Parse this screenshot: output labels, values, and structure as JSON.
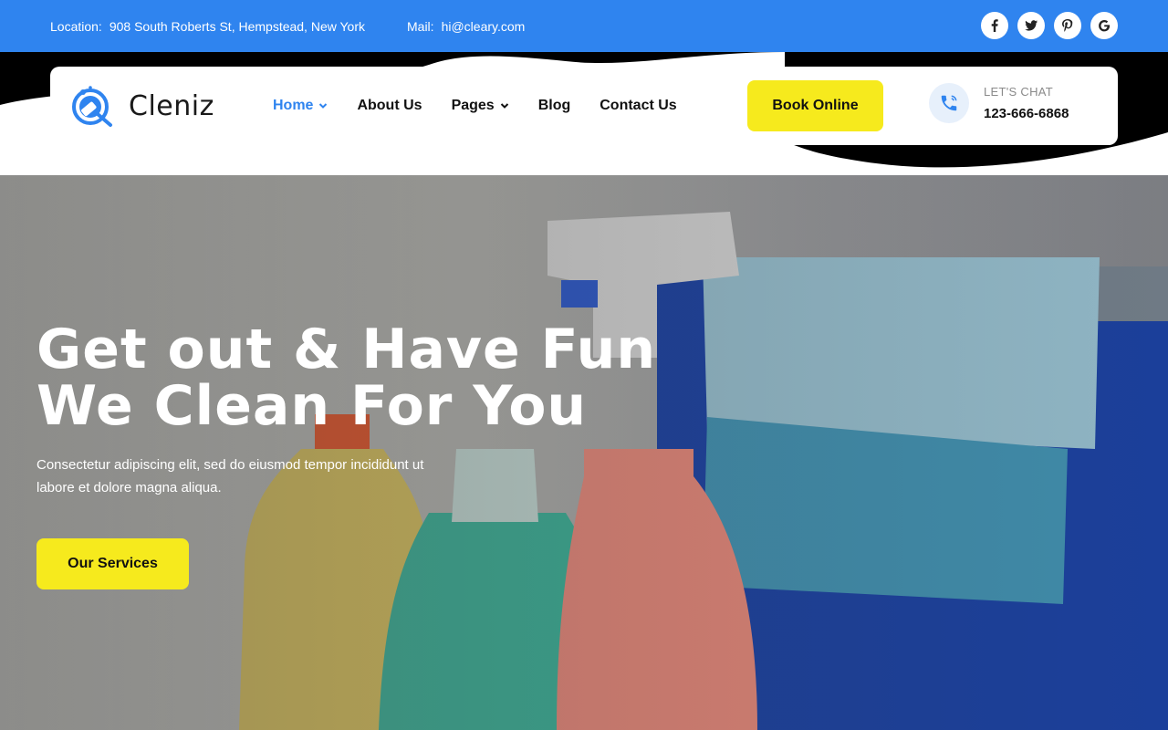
{
  "topbar": {
    "location_label": "Location:",
    "location_value": "908 South Roberts St, Hempstead, New York",
    "mail_label": "Mail:",
    "mail_value": "hi@cleary.com",
    "social": [
      "facebook-icon",
      "twitter-icon",
      "pinterest-icon",
      "google-icon"
    ]
  },
  "brand": {
    "name": "Cleniz"
  },
  "nav": {
    "items": [
      {
        "label": "Home",
        "has_dropdown": true,
        "active": true
      },
      {
        "label": "About Us",
        "has_dropdown": false
      },
      {
        "label": "Pages",
        "has_dropdown": true
      },
      {
        "label": "Blog",
        "has_dropdown": false
      },
      {
        "label": "Contact Us",
        "has_dropdown": false
      }
    ],
    "book_label": "Book Online",
    "chat_label": "LET'S CHAT",
    "chat_phone": "123-666-6868"
  },
  "hero": {
    "headline_line1": "Get out & Have Fun",
    "headline_line2": "We Clean For You",
    "subtext": "Consectetur adipiscing elit, sed do eiusmod tempor incididunt ut labore et dolore magna aliqua.",
    "cta_label": "Our Services"
  },
  "colors": {
    "primary": "#2f84ef",
    "accent": "#f6ea1d",
    "dark": "#000000"
  }
}
